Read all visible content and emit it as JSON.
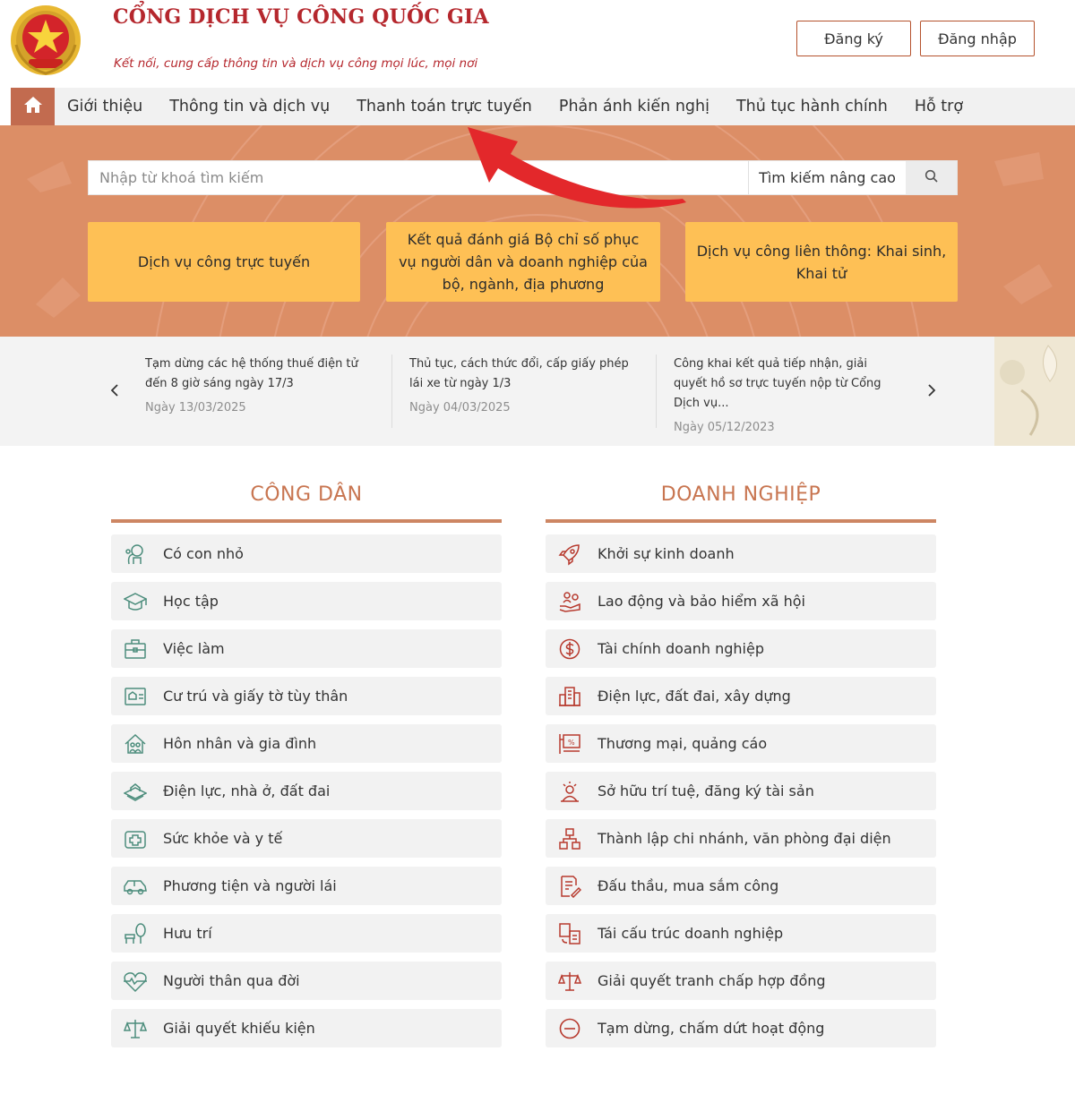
{
  "header": {
    "title": "CỔNG DỊCH VỤ CÔNG QUỐC GIA",
    "slogan": "Kết nối, cung cấp thông tin và dịch vụ công mọi lúc, mọi nơi",
    "register_label": "Đăng ký",
    "login_label": "Đăng nhập",
    "brand_color": "#b5272d"
  },
  "nav": {
    "home_icon": "home-icon",
    "items": [
      {
        "label": "Giới thiệu"
      },
      {
        "label": "Thông tin và dịch vụ"
      },
      {
        "label": "Thanh toán trực tuyến"
      },
      {
        "label": "Phản ánh kiến nghị"
      },
      {
        "label": "Thủ tục hành chính"
      },
      {
        "label": "Hỗ trợ"
      }
    ]
  },
  "search": {
    "placeholder": "Nhập từ khoá tìm kiếm",
    "value": "",
    "advanced_label": "Tìm kiếm nâng cao",
    "button_icon": "search-icon"
  },
  "quick_links": [
    {
      "label": "Dịch vụ công trực tuyến"
    },
    {
      "label": "Kết quả đánh giá Bộ chỉ số phục vụ người dân và doanh nghiệp của bộ, ngành, địa phương"
    },
    {
      "label": "Dịch vụ công liên thông: Khai sinh, Khai tử"
    }
  ],
  "news": [
    {
      "title": "Tạm dừng các hệ thống thuế điện tử đến 8 giờ sáng ngày 17/3",
      "date": "Ngày 13/03/2025"
    },
    {
      "title": "Thủ tục, cách thức đổi, cấp giấy phép lái xe từ ngày 1/3",
      "date": "Ngày 04/03/2025"
    },
    {
      "title": "Công khai kết quả tiếp nhận, giải quyết hồ sơ trực tuyến nộp từ Cổng Dịch vụ...",
      "date": "Ngày 05/12/2023"
    }
  ],
  "citizen": {
    "title": "CÔNG DÂN",
    "items": [
      {
        "label": "Có con nhỏ",
        "icon": "baby-icon"
      },
      {
        "label": "Học tập",
        "icon": "graduation-cap-icon"
      },
      {
        "label": "Việc làm",
        "icon": "briefcase-icon"
      },
      {
        "label": "Cư trú và giấy tờ tùy thân",
        "icon": "id-card-icon"
      },
      {
        "label": "Hôn nhân và gia đình",
        "icon": "family-home-icon"
      },
      {
        "label": "Điện lực, nhà ở, đất đai",
        "icon": "land-house-icon"
      },
      {
        "label": "Sức khỏe và y tế",
        "icon": "medical-cross-icon"
      },
      {
        "label": "Phương tiện và người lái",
        "icon": "car-icon"
      },
      {
        "label": "Hưu trí",
        "icon": "bench-tree-icon"
      },
      {
        "label": "Người thân qua đời",
        "icon": "heartbeat-icon"
      },
      {
        "label": "Giải quyết khiếu kiện",
        "icon": "scales-icon"
      }
    ]
  },
  "business": {
    "title": "DOANH NGHIỆP",
    "items": [
      {
        "label": "Khởi sự kinh doanh",
        "icon": "rocket-icon"
      },
      {
        "label": "Lao động và bảo hiểm xã hội",
        "icon": "insurance-hand-icon"
      },
      {
        "label": "Tài chính doanh nghiệp",
        "icon": "dollar-coin-icon"
      },
      {
        "label": "Điện lực, đất đai, xây dựng",
        "icon": "building-icon"
      },
      {
        "label": "Thương mại, quảng cáo",
        "icon": "billboard-icon"
      },
      {
        "label": "Sở hữu trí tuệ, đăng ký tài sản",
        "icon": "idea-person-icon"
      },
      {
        "label": "Thành lập chi nhánh, văn phòng đại diện",
        "icon": "org-chart-icon"
      },
      {
        "label": "Đấu thầu, mua sắm công",
        "icon": "document-pen-icon"
      },
      {
        "label": "Tái cấu trúc doanh nghiệp",
        "icon": "restructure-icon"
      },
      {
        "label": "Giải quyết tranh chấp hợp đồng",
        "icon": "scales-icon"
      },
      {
        "label": "Tạm dừng, chấm dứt hoạt động",
        "icon": "minus-circle-icon"
      }
    ]
  },
  "colors": {
    "hero_bg": "#dc8e66",
    "card_bg": "#fec055",
    "accent": "#c87550",
    "icon_green": "#4c8d7c",
    "icon_red": "#b73a2e",
    "annotation_arrow": "#e3282b"
  }
}
